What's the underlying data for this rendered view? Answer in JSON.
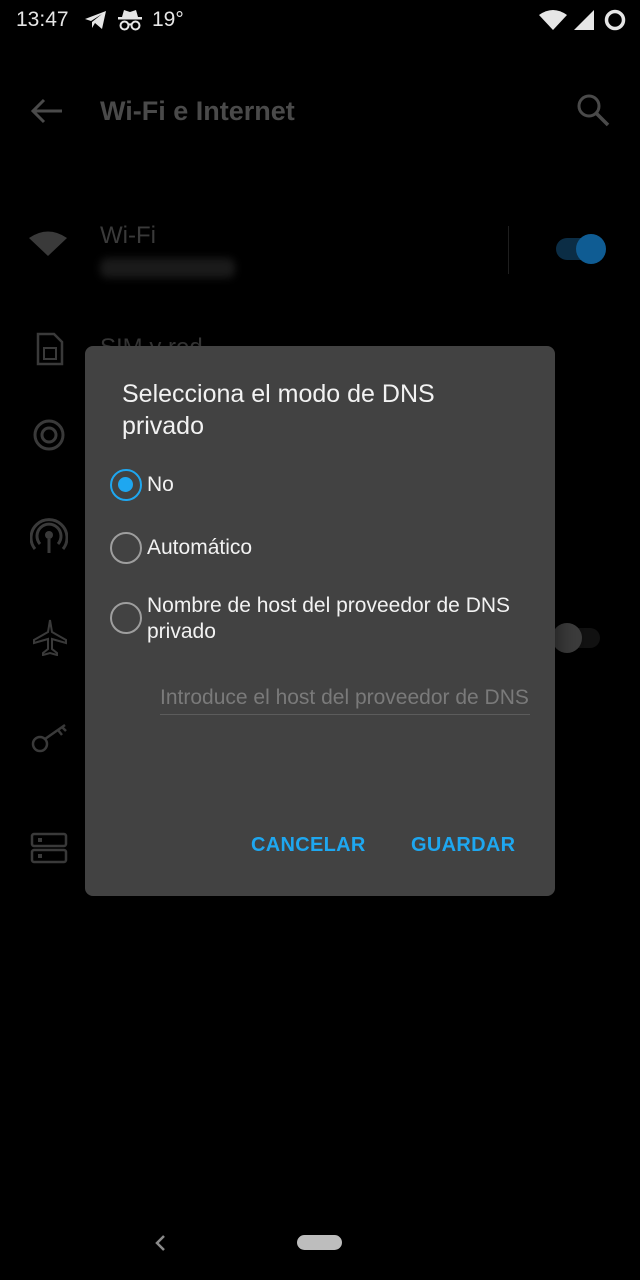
{
  "status_bar": {
    "time": "13:47",
    "temperature": "19°"
  },
  "app_bar": {
    "title": "Wi-Fi e Internet"
  },
  "settings": {
    "wifi_label": "Wi-Fi",
    "sim_label_partial": "SIM y red",
    "wifi_toggle_on": true,
    "hotspot_toggle_on": false
  },
  "dialog": {
    "title": "Selecciona el modo de DNS privado",
    "options": [
      {
        "label": "No",
        "checked": true
      },
      {
        "label": "Automático",
        "checked": false
      },
      {
        "label": "Nombre de host del proveedor de DNS privado",
        "checked": false
      }
    ],
    "host_input": {
      "value": "",
      "placeholder": "Introduce el host del proveedor de DNS"
    },
    "cancel_label": "CANCELAR",
    "save_label": "GUARDAR"
  },
  "colors": {
    "accent": "#1ea7f0",
    "dialog_bg": "#424242",
    "background": "#000000"
  },
  "icons": [
    "telegram-icon",
    "incognito-icon",
    "wifi-signal-icon",
    "cell-signal-icon",
    "battery-ring-icon",
    "back-arrow-icon",
    "search-icon",
    "wifi-icon",
    "sim-card-icon",
    "data-usage-icon",
    "hotspot-icon",
    "airplane-icon",
    "vpn-key-icon",
    "dns-icon"
  ]
}
